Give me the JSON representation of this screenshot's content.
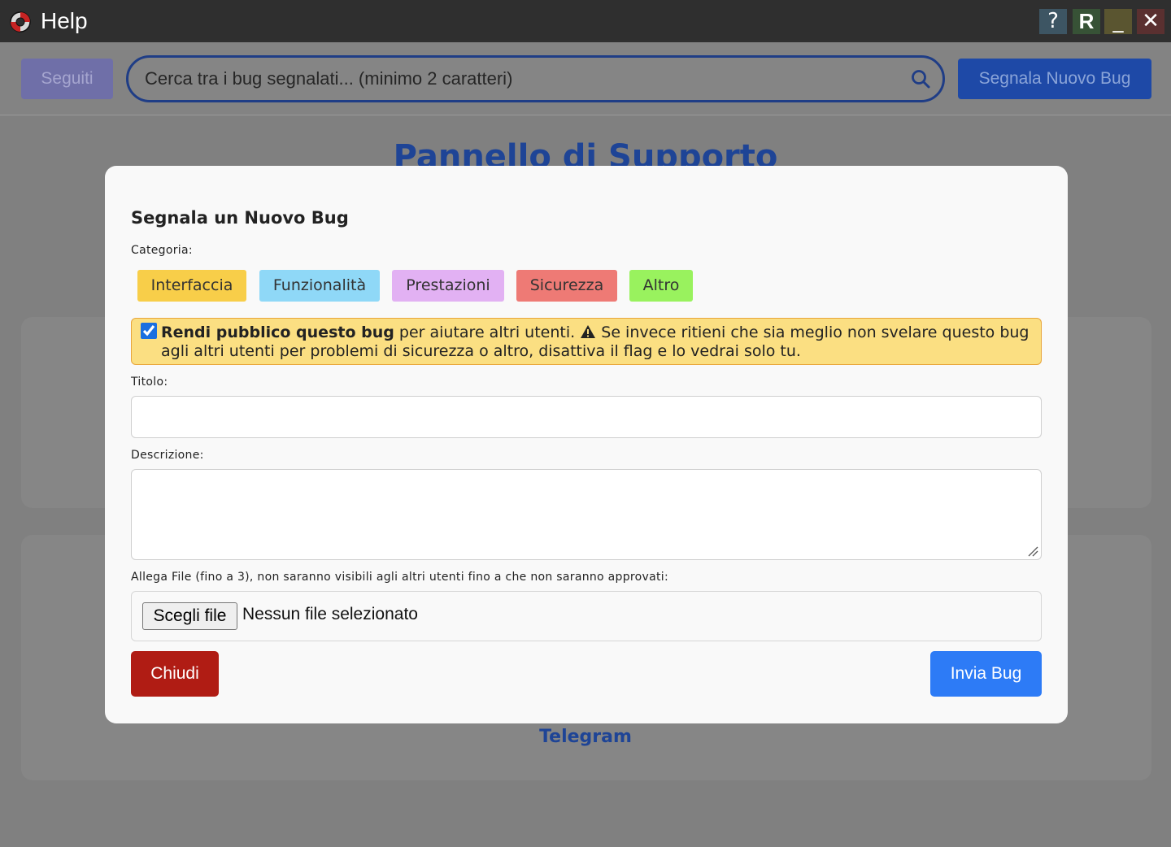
{
  "window": {
    "title": "Help",
    "help_label": "?",
    "reload_label": "R",
    "minimize_label": "_",
    "close_label": "✕"
  },
  "toolbar": {
    "followed_label": "Seguiti",
    "search_placeholder": "Cerca tra i bug segnalati... (minimo 2 caratteri)",
    "new_bug_label": "Segnala Nuovo Bug"
  },
  "background": {
    "page_title": "Pannello di Supporto",
    "telegram_label": "Telegram"
  },
  "modal": {
    "title": "Segnala un Nuovo Bug",
    "category_label": "Categoria:",
    "categories": [
      {
        "label": "Interfaccia",
        "color": "#f8ce49"
      },
      {
        "label": "Funzionalità",
        "color": "#8fd8f7"
      },
      {
        "label": "Prestazioni",
        "color": "#e2b1f3"
      },
      {
        "label": "Sicurezza",
        "color": "#ee7a75"
      },
      {
        "label": "Altro",
        "color": "#99f25e"
      }
    ],
    "public_checked": true,
    "public_bold": "Rendi pubblico questo bug",
    "public_text": " per aiutare altri utenti. ",
    "public_warning": " Se invece ritieni che sia meglio non svelare questo bug agli altri utenti per problemi di sicurezza o altro, disattiva il flag e lo vedrai solo tu.",
    "title_label": "Titolo:",
    "title_value": "",
    "description_label": "Descrizione:",
    "description_value": "",
    "attach_label": "Allega File (fino a 3), non saranno visibili agli altri utenti fino a che non saranno approvati:",
    "choose_file_label": "Scegli file",
    "file_status": "Nessun file selezionato",
    "close_label": "Chiudi",
    "send_label": "Invia Bug"
  },
  "colors": {
    "primary": "#2d7bf6",
    "danger": "#b01c14",
    "warning_bg": "#fbdf82"
  }
}
